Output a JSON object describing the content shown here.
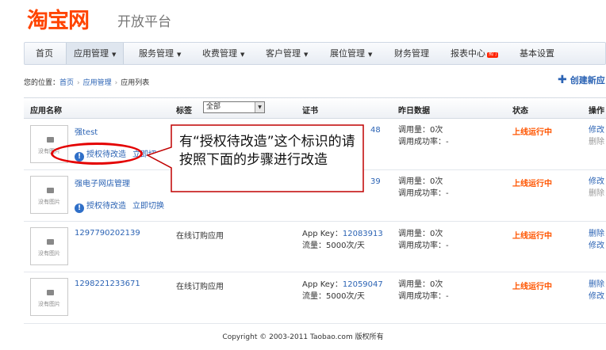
{
  "logo": {
    "main": "淘宝网",
    "sub": "开放平台"
  },
  "nav": {
    "items": [
      {
        "label": "首页"
      },
      {
        "label": "应用管理"
      },
      {
        "label": "服务管理"
      },
      {
        "label": "收费管理"
      },
      {
        "label": "客户管理"
      },
      {
        "label": "展位管理"
      },
      {
        "label": "财务管理"
      },
      {
        "label": "报表中心",
        "badge": "热门"
      },
      {
        "label": "基本设置"
      }
    ]
  },
  "breadcrumb": {
    "prefix": "您的位置：",
    "items": [
      "首页",
      "应用管理",
      "应用列表"
    ]
  },
  "create_button": {
    "label": "创建新应"
  },
  "table": {
    "headers": {
      "name": "应用名称",
      "tag": "标签",
      "cert": "证书",
      "stats": "昨日数据",
      "status": "状态",
      "ops": "操作"
    },
    "filter": {
      "selected": "全部"
    },
    "no_pic": "没有图片",
    "rows": [
      {
        "name": "强test",
        "warn": "授权待改造",
        "switch": "立即切",
        "tag": "",
        "cert_key_value": "48",
        "calls": "调用量：0次",
        "success": "调用成功率：-",
        "status": "上线运行中",
        "op1": "修改",
        "op2": "删除"
      },
      {
        "name": "强电子网店管理",
        "warn": "授权待改造",
        "switch": "立即切换",
        "tag": "",
        "cert_key_value": "39",
        "calls": "调用量：0次",
        "success": "调用成功率：-",
        "status": "上线运行中",
        "op1": "修改",
        "op2": "删除"
      },
      {
        "name": "1297790202139",
        "tag": "在线订购应用",
        "cert_key_label": "App Key：",
        "cert_key_value": "12083913",
        "cert_flow": "流量：5000次/天",
        "calls": "调用量：0次",
        "success": "调用成功率：-",
        "status": "上线运行中",
        "op1": "删除",
        "op2": "修改"
      },
      {
        "name": "1298221233671",
        "tag": "在线订购应用",
        "cert_key_label": "App Key：",
        "cert_key_value": "12059047",
        "cert_flow": "流量：5000次/天",
        "calls": "调用量：0次",
        "success": "调用成功率：-",
        "status": "上线运行中",
        "op1": "删除",
        "op2": "修改"
      }
    ]
  },
  "annotation": {
    "text": "有“授权待改造”这个标识的请按照下面的步骤进行改造"
  },
  "footer": {
    "text": "Copyright © 2003-2011 Taobao.com 版权所有"
  }
}
